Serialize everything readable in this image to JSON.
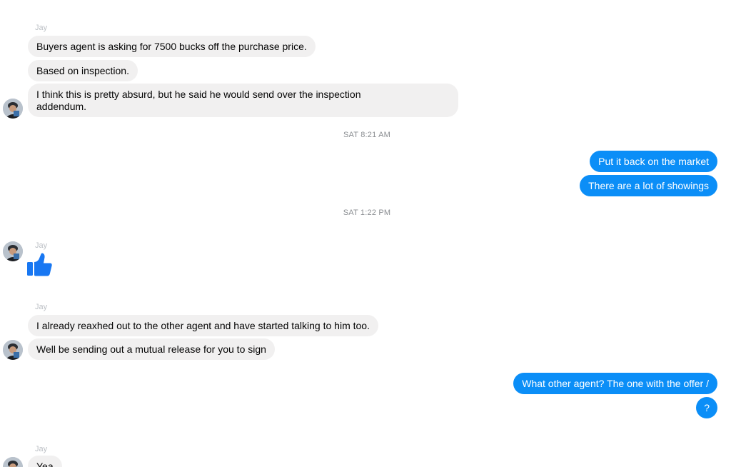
{
  "conversation": {
    "group1": {
      "sender": "Jay",
      "messages": [
        "Buyers agent is asking for 7500 bucks off the purchase price.",
        "Based on inspection.",
        "I think this is pretty absurd, but he said he would send over the inspection addendum."
      ]
    },
    "timestamp1": "SAT 8:21 AM",
    "outgoing1": [
      "Put it back on the market",
      "There are a lot of showings"
    ],
    "timestamp2": "SAT 1:22 PM",
    "group2": {
      "sender": "Jay",
      "reaction": "thumbs-up-icon"
    },
    "group3": {
      "sender": "Jay",
      "messages": [
        "I already reaxhed out to the other agent and have started talking to him too.",
        "Well be sending out a mutual release for you to sign"
      ]
    },
    "outgoing2": [
      "What other agent?  The one with the offer /",
      "?"
    ],
    "group4": {
      "sender": "Jay",
      "messages": [
        "Yea"
      ]
    }
  },
  "colors": {
    "incoming_bubble": "#f1f0f0",
    "outgoing_bubble": "#0b8ef7",
    "like_icon": "#1877f2"
  }
}
